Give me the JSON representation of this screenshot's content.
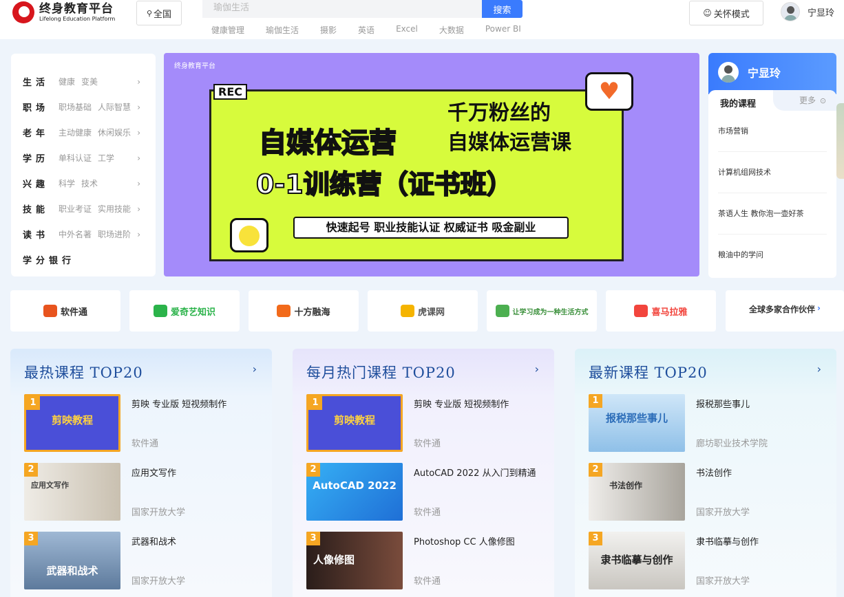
{
  "header": {
    "logo_cn": "终身教育平台",
    "logo_en": "Lifelong Education Platform",
    "region": "全国",
    "search_placeholder": "瑜伽生活",
    "search_button": "搜索",
    "hot_tags": [
      "健康管理",
      "瑜伽生活",
      "摄影",
      "英语",
      "Excel",
      "大数据",
      "Power BI"
    ],
    "care_mode": "关怀模式",
    "username": "宁显玲"
  },
  "categories": [
    {
      "name": "生活",
      "subs": [
        "健康",
        "变美"
      ]
    },
    {
      "name": "职场",
      "subs": [
        "职场基础",
        "人际智慧"
      ]
    },
    {
      "name": "老年",
      "subs": [
        "主动健康",
        "休闲娱乐"
      ]
    },
    {
      "name": "学历",
      "subs": [
        "单科认证",
        "工学"
      ]
    },
    {
      "name": "兴趣",
      "subs": [
        "科学",
        "技术"
      ]
    },
    {
      "name": "技能",
      "subs": [
        "职业考证",
        "实用技能"
      ]
    },
    {
      "name": "读书",
      "subs": [
        "中外名著",
        "职场进阶"
      ]
    },
    {
      "name": "学分银行",
      "subs": []
    }
  ],
  "banner": {
    "logo": "终身教育平台",
    "rec": "REC",
    "line1": "千万粉丝的",
    "line2": "自媒体运营",
    "line3": "自媒体运营课",
    "line4": "0-1训练营（证书班）",
    "tagline": "快速起号 职业技能认证 权威证书 吸金副业"
  },
  "user_card": {
    "name": "宁显玲",
    "tab_mine": "我的课程",
    "tab_more": "更多",
    "courses": [
      "市场营销",
      "计算机组网技术",
      "茶语人生 教你泡一壶好茶",
      "粮油中的学问"
    ]
  },
  "partners": [
    {
      "name": "软件通",
      "color": "#e8541e"
    },
    {
      "name": "爱奇艺知识",
      "color": "#2bb34a"
    },
    {
      "name": "十方融海",
      "color": "#f26a1b"
    },
    {
      "name": "虎课网",
      "color": "#f5b400"
    },
    {
      "name": "让学习成为一种生活方式",
      "color": "#4caf50"
    },
    {
      "name": "喜马拉雅",
      "color": "#f2453d"
    },
    {
      "name": "全球多家合作伙伴",
      "color": "#3a7bfd"
    }
  ],
  "columns": {
    "hot": {
      "title": "最热课程 TOP20",
      "courses": [
        {
          "rank": "1",
          "title": "剪映 专业版 短视频制作",
          "source": "软件通",
          "thumb": "剪映教程",
          "color": "#4a4fd8"
        },
        {
          "rank": "2",
          "title": "应用文写作",
          "source": "国家开放大学",
          "thumb": "应用文写作",
          "color": "#c9c0b0"
        },
        {
          "rank": "3",
          "title": "武器和战术",
          "source": "国家开放大学",
          "thumb": "武器和战术",
          "color": "#6f8fb4"
        }
      ]
    },
    "month": {
      "title": "每月热门课程 TOP20",
      "courses": [
        {
          "rank": "1",
          "title": "剪映 专业版 短视频制作",
          "source": "软件通",
          "thumb": "剪映教程",
          "color": "#4a4fd8"
        },
        {
          "rank": "2",
          "title": "AutoCAD 2022 从入门到精通",
          "source": "软件通",
          "thumb": "AutoCAD 2022",
          "color": "#1f8fe6"
        },
        {
          "rank": "3",
          "title": "Photoshop CC 人像修图",
          "source": "软件通",
          "thumb": "人像修图",
          "color": "#5a3a30"
        }
      ]
    },
    "new": {
      "title": "最新课程 TOP20",
      "courses": [
        {
          "rank": "1",
          "title": "报税那些事儿",
          "source": "廊坊职业技术学院",
          "thumb": "报税那些事儿",
          "color": "#8fc0e8"
        },
        {
          "rank": "2",
          "title": "书法创作",
          "source": "国家开放大学",
          "thumb": "书法创作",
          "color": "#b9b5ad"
        },
        {
          "rank": "3",
          "title": "隶书临摹与创作",
          "source": "国家开放大学",
          "thumb": "隶书临摹与创作",
          "color": "#d8d6d2"
        }
      ]
    }
  }
}
